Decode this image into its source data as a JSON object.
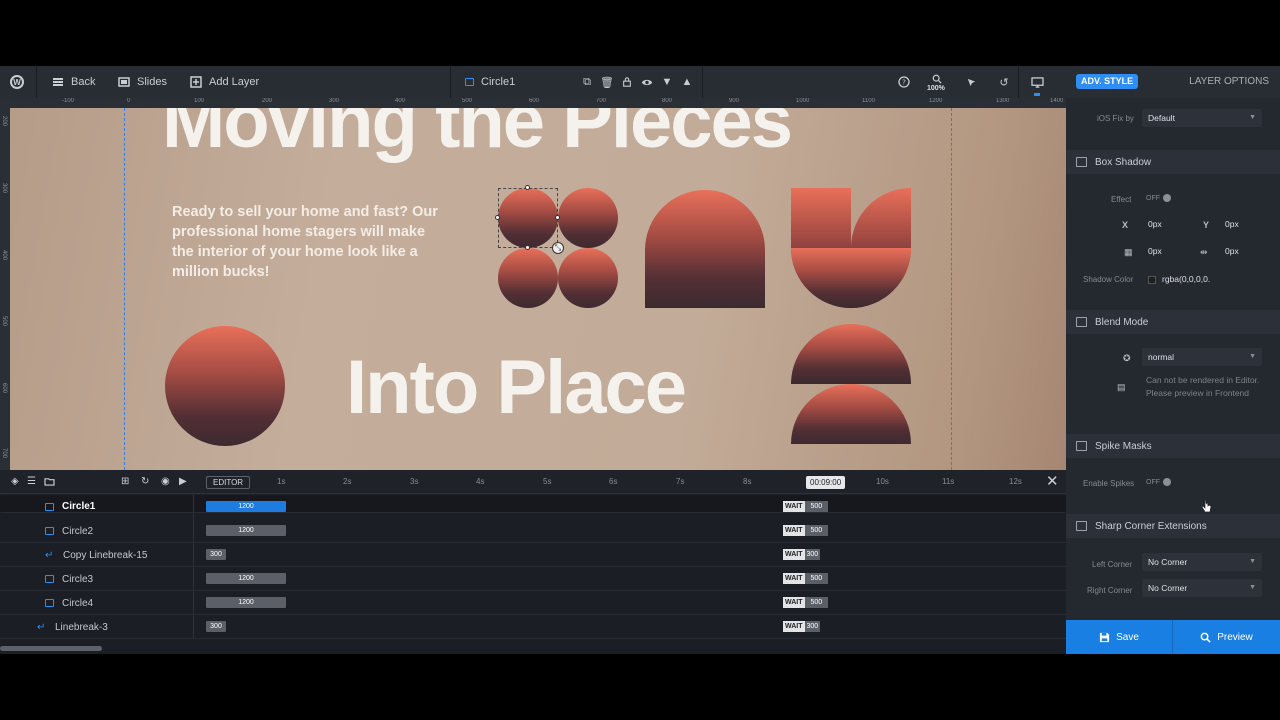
{
  "topbar": {
    "back": "Back",
    "slides": "Slides",
    "add_layer": "Add Layer",
    "layer_name": "Circle1",
    "zoom": "100%"
  },
  "right_header": {
    "adv_style": "ADV. STYLE",
    "layer_options": "LAYER OPTIONS"
  },
  "ruler": {
    "top_labels": [
      "-100",
      "0",
      "100",
      "200",
      "300",
      "400",
      "500",
      "600",
      "700",
      "800",
      "900",
      "1000",
      "1100",
      "1200",
      "1300",
      "1400"
    ],
    "left_labels": [
      "200",
      "300",
      "400",
      "500",
      "600",
      "700"
    ]
  },
  "canvas": {
    "headline_top": "Moving the Pieces",
    "headline_bottom": "Into Place",
    "paragraph": "Ready to sell your home and fast? Our professional home stagers will make the interior of your home look like a million bucks!"
  },
  "timeline": {
    "editor": "EDITOR",
    "time": "00:09:00",
    "ticks": [
      "1s",
      "2s",
      "3s",
      "4s",
      "5s",
      "6s",
      "7s",
      "8s",
      "10s",
      "11s",
      "12s"
    ],
    "rows": [
      {
        "name": "Circle1",
        "bar": "1200",
        "wait": "WAIT",
        "wait_val": "500",
        "icon": "layer"
      },
      {
        "name": "Circle2",
        "bar": "1200",
        "wait": "WAIT",
        "wait_val": "500",
        "icon": "layer"
      },
      {
        "name": "Copy Linebreak-15",
        "bar": "300",
        "wait": "WAIT",
        "wait_val": "300",
        "icon": "linebreak"
      },
      {
        "name": "Circle3",
        "bar": "1200",
        "wait": "WAIT",
        "wait_val": "500",
        "icon": "layer"
      },
      {
        "name": "Circle4",
        "bar": "1200",
        "wait": "WAIT",
        "wait_val": "500",
        "icon": "layer"
      },
      {
        "name": "Linebreak-3",
        "bar": "300",
        "wait": "WAIT",
        "wait_val": "300",
        "icon": "linebreak"
      }
    ]
  },
  "panel": {
    "ios_fix_label": "iOS Fix by",
    "ios_fix_value": "Default",
    "box_shadow": "Box Shadow",
    "effect_label": "Effect",
    "effect_value": "OFF",
    "x_label": "X",
    "x_value": "0px",
    "y_label": "Y",
    "y_value": "0px",
    "blur_value": "0px",
    "spread_value": "0px",
    "shadow_color_label": "Shadow Color",
    "shadow_color_value": "rgba(0,0,0,0.",
    "blend_mode": "Blend Mode",
    "blend_value": "normal",
    "blend_note": "Can not be rendered in Editor. Please preview in Frontend",
    "spike_masks": "Spike Masks",
    "enable_spikes_label": "Enable Spikes",
    "enable_spikes_value": "OFF",
    "sharp_corner": "Sharp Corner Extensions",
    "left_corner_label": "Left Corner",
    "left_corner_value": "No Corner",
    "right_corner_label": "Right Corner",
    "right_corner_value": "No Corner"
  },
  "buttons": {
    "save": "Save",
    "preview": "Preview"
  }
}
